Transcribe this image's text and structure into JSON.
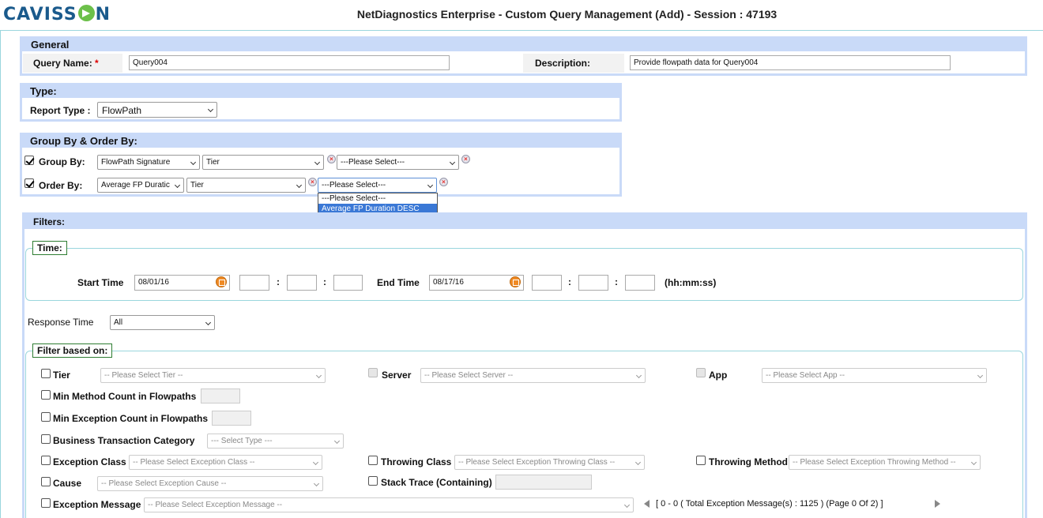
{
  "app": {
    "logo": "CAVISSON",
    "title": "NetDiagnostics Enterprise - Custom Query Management (Add) - Session : 47193"
  },
  "general": {
    "header": "General",
    "query_name_label": "Query Name:",
    "required_mark": "*",
    "query_name_value": "Query004",
    "description_label": "Description:",
    "description_value": "Provide flowpath data for Query004"
  },
  "type": {
    "header": "Type:",
    "report_type_label": "Report Type :",
    "report_type_value": "FlowPath"
  },
  "group_order": {
    "header": "Group By & Order By:",
    "group_by_label": "Group By:",
    "group_by": [
      "FlowPath Signature",
      "Tier",
      "---Please Select---"
    ],
    "order_by_label": "Order By:",
    "order_by": [
      "Average FP Duratic",
      "Tier",
      "---Please Select---"
    ],
    "dropdown_options": [
      "---Please Select---",
      "Average FP Duration DESC"
    ]
  },
  "filters": {
    "header": "Filters:",
    "time_legend": "Time:",
    "start_time_label": "Start Time",
    "start_date": "08/01/16",
    "end_time_label": "End Time",
    "end_date": "08/17/16",
    "time_sep": ":",
    "time_format": "(hh:mm:ss)",
    "response_time_label": "Response Time",
    "response_time_value": "All",
    "filter_legend": "Filter based on:",
    "tier_label": "Tier",
    "tier_placeholder": "-- Please Select Tier --",
    "server_label": "Server",
    "server_placeholder": "-- Please Select Server --",
    "app_label": "App",
    "app_placeholder": "-- Please Select App --",
    "min_method_label": "Min Method Count in Flowpaths",
    "min_exception_label": "Min Exception Count in Flowpaths",
    "btc_label": "Business Transaction Category",
    "btc_placeholder": "--- Select Type ---",
    "exc_class_label": "Exception Class",
    "exc_class_placeholder": "-- Please Select Exception Class --",
    "throw_class_label": "Throwing Class",
    "throw_class_placeholder": "-- Please Select Exception Throwing Class --",
    "throw_method_label": "Throwing Method",
    "throw_method_placeholder": "-- Please Select Exception Throwing Method --",
    "cause_label": "Cause",
    "cause_placeholder": "-- Please Select Exception Cause --",
    "stack_trace_label": "Stack Trace (Containing)",
    "exc_msg_label": "Exception Message",
    "exc_msg_placeholder": "-- Please Select Exception Message --",
    "pager_text": "[ 0 - 0 ( Total Exception Message(s) : 1125 ) (Page 0 Of 2) ]"
  }
}
